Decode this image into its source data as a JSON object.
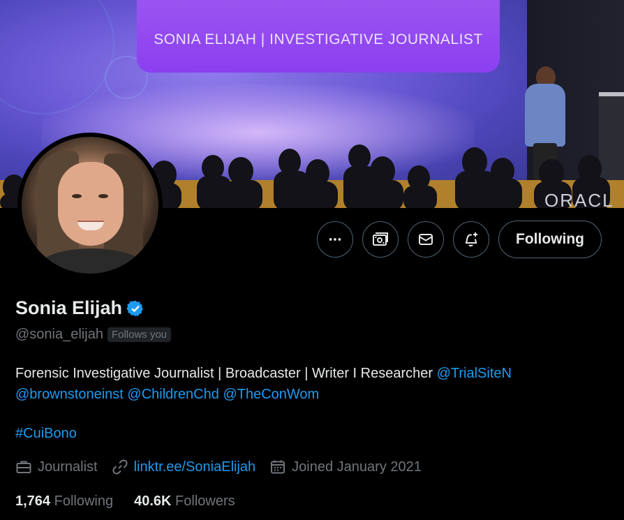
{
  "banner": {
    "title_card_text": "SONIA ELIJAH | INVESTIGATIVE JOURNALIST",
    "backdrop_text": "ORACL"
  },
  "actions": {
    "more_icon": "more-horizontal-icon",
    "subscribe_icon": "money-icon",
    "message_icon": "envelope-icon",
    "notify_icon": "bell-plus-icon",
    "follow_label": "Following"
  },
  "profile": {
    "name": "Sonia Elijah",
    "verified_icon": "verified-badge-icon",
    "handle": "@sonia_elijah",
    "follows_you": "Follows you",
    "bio_text": "Forensic Investigative Journalist | Broadcaster | Writer I Researcher ",
    "bio_mentions": [
      "@TrialSiteN",
      "@brownstoneinst",
      "@ChildrenChd",
      "@TheConWom"
    ],
    "hashtag": "#CuiBono",
    "profession": "Journalist",
    "website": "linktr.ee/SoniaElijah",
    "joined": "Joined January 2021",
    "following_count": "1,764",
    "following_label": "Following",
    "followers_count": "40.6K",
    "followers_label": "Followers"
  },
  "colors": {
    "background": "#000000",
    "text": "#e7e9ea",
    "muted": "#71767b",
    "link": "#1d9bf0",
    "border": "#536471",
    "title_card": "#8b3ff0"
  }
}
